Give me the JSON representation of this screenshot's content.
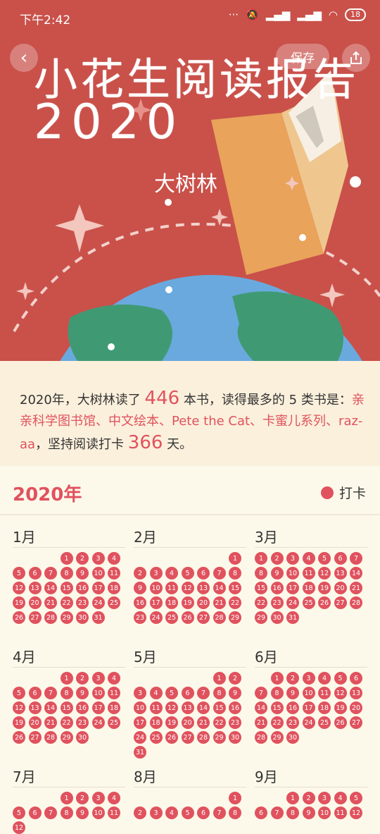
{
  "status_bar": {
    "time": "下午2:42",
    "battery": "18"
  },
  "nav": {
    "back_icon": "chevron-left-icon",
    "save_label": "保存",
    "share_icon": "share-icon"
  },
  "header": {
    "title_line1": "小花生阅读报告",
    "title_line2": "2020",
    "child_name": "大树林"
  },
  "colors": {
    "hero_bg": "#c9514a",
    "accent": "#e0525e",
    "page_bg": "#fdf9ea",
    "summary_bg": "#fbf0dc"
  },
  "summary": {
    "part1": "2020年，大树林读了",
    "books_count": "446",
    "part2": "本书，读得最多的 5 类书是：",
    "categories": "亲亲科学图书馆、中文绘本、Pete the Cat、卡蜜儿系列、raz-aa",
    "part3": "，坚持阅读打卡",
    "checkin_days": "366",
    "part4": "天。"
  },
  "calendar": {
    "year_label": "2020年",
    "legend_label": "打卡",
    "months": [
      {
        "label": "1月",
        "offset": 3,
        "days": 31
      },
      {
        "label": "2月",
        "offset": 6,
        "days": 29
      },
      {
        "label": "3月",
        "offset": 0,
        "days": 31
      },
      {
        "label": "4月",
        "offset": 3,
        "days": 30
      },
      {
        "label": "5月",
        "offset": 5,
        "days": 31
      },
      {
        "label": "6月",
        "offset": 1,
        "days": 30
      },
      {
        "label": "7月",
        "offset": 3,
        "days": 12
      },
      {
        "label": "8月",
        "offset": 6,
        "days": 8
      },
      {
        "label": "9月",
        "offset": 2,
        "days": 12
      }
    ]
  }
}
